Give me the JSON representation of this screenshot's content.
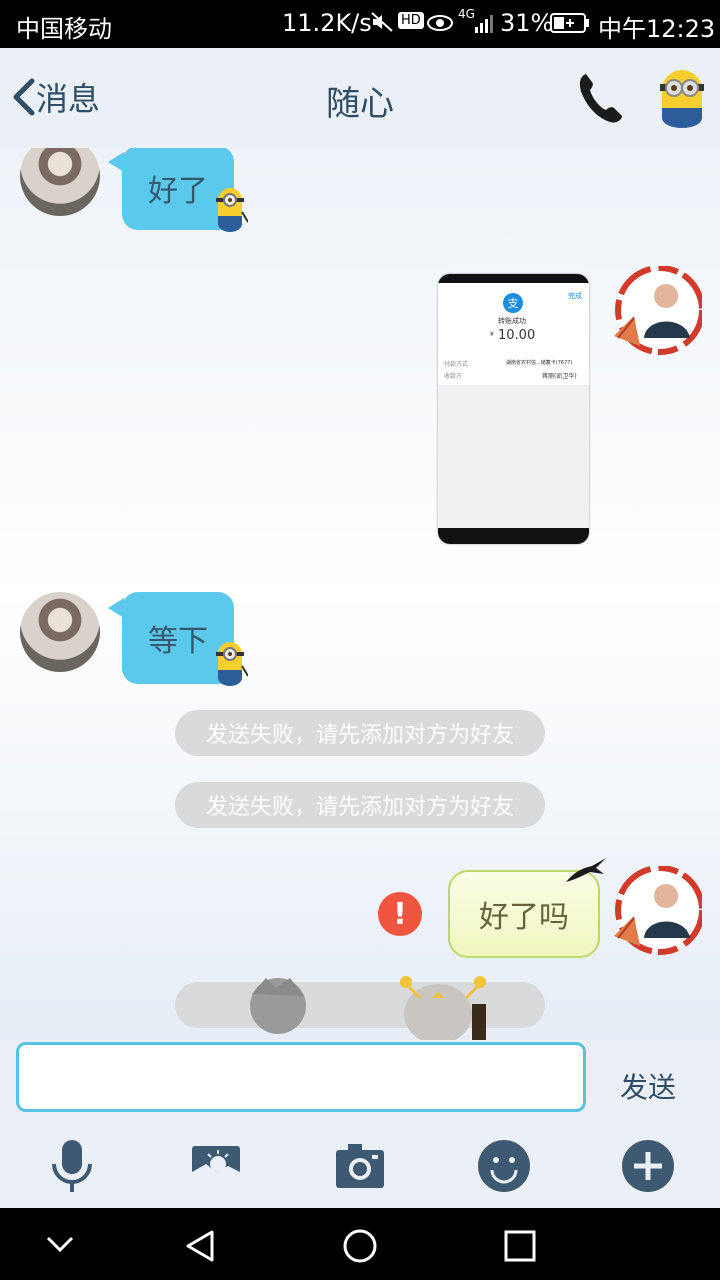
{
  "status_bar": {
    "carrier": "中国移动",
    "speed": "11.2K/s",
    "network": "4G",
    "battery": "31%",
    "time": "中午12:23"
  },
  "header": {
    "back_label": "消息",
    "title": "随心"
  },
  "messages": [
    {
      "side": "in",
      "type": "text",
      "text": "好了"
    },
    {
      "side": "out",
      "type": "image",
      "image_text": {
        "status": "转账成功",
        "amount": "10.00",
        "currency": "¥",
        "done": "完成",
        "label1": "付款方式",
        "value1": "湖南省农村信...储蓄卡(7677)",
        "label2": "收款方",
        "value2": "蒋丽(凯卫华)"
      }
    },
    {
      "side": "in",
      "type": "text",
      "text": "等下"
    },
    {
      "side": "system",
      "type": "tip",
      "text": "发送失败，请先添加对方为好友"
    },
    {
      "side": "system",
      "type": "tip",
      "text": "发送失败，请先添加对方为好友"
    },
    {
      "side": "out",
      "type": "text",
      "text": "好了吗",
      "failed_icon": "!"
    }
  ],
  "input": {
    "value": "",
    "send_label": "发送"
  },
  "toolbar": {
    "icons": [
      "mic-icon",
      "photo-icon",
      "camera-icon",
      "emoji-icon",
      "plus-icon"
    ]
  },
  "colors": {
    "accent": "#56c3e4",
    "bubble_in": "#5bc9ec",
    "error": "#f0553f",
    "icon": "#3e5a72"
  }
}
